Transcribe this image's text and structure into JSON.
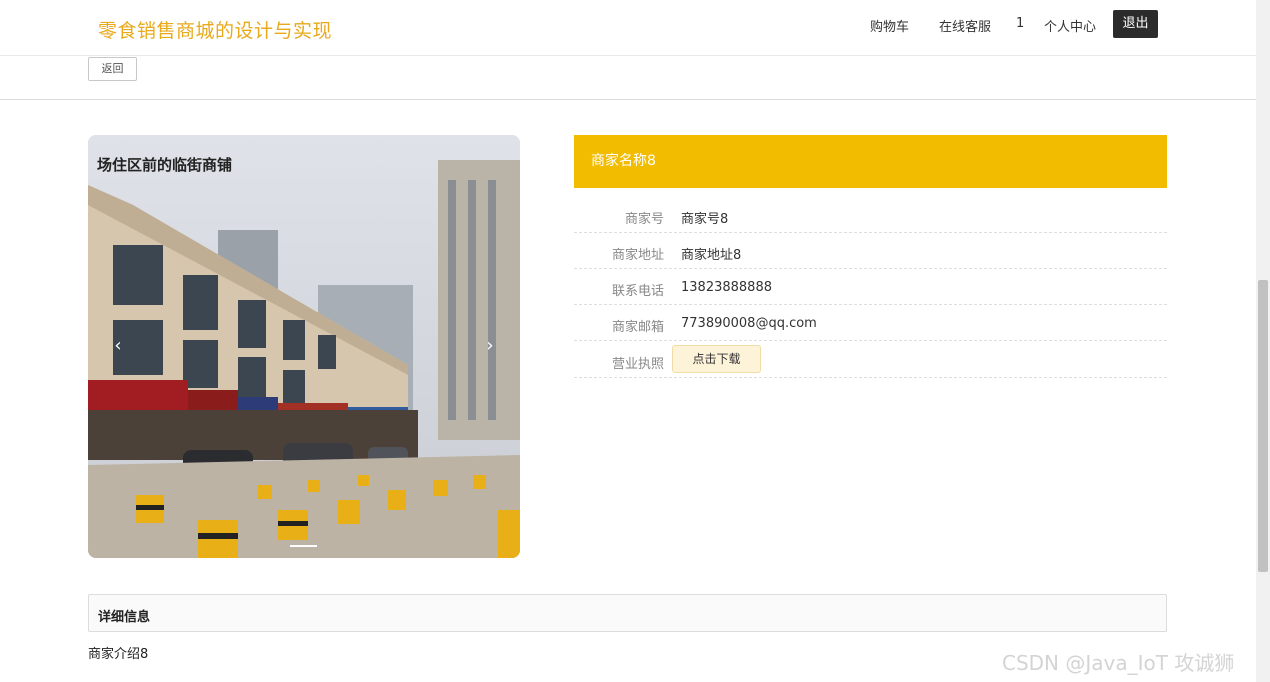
{
  "header": {
    "site_title": "零食销售商城的设计与实现",
    "nav": {
      "cart": "购物车",
      "service": "在线客服",
      "user": "1",
      "profile": "个人中心",
      "logout": "退出"
    }
  },
  "toolbar": {
    "back_label": "返回"
  },
  "carousel": {
    "caption": "场住区前的临街商铺",
    "prev_icon": "‹",
    "next_icon": "›"
  },
  "merchant": {
    "name": "商家名称8",
    "fields": [
      {
        "label": "商家号",
        "value": "商家号8"
      },
      {
        "label": "商家地址",
        "value": "商家地址8"
      },
      {
        "label": "联系电话",
        "value": "13823888888"
      },
      {
        "label": "商家邮箱",
        "value": "773890008@qq.com"
      },
      {
        "label": "营业执照",
        "button": "点击下载"
      }
    ]
  },
  "details": {
    "title": "详细信息",
    "text": "商家介绍8"
  },
  "watermark": "CSDN @Java_IoT 攻诚狮",
  "colors": {
    "accent": "#f2bc00",
    "title": "#e8a91b",
    "logout_bg": "#2b2b2b"
  }
}
